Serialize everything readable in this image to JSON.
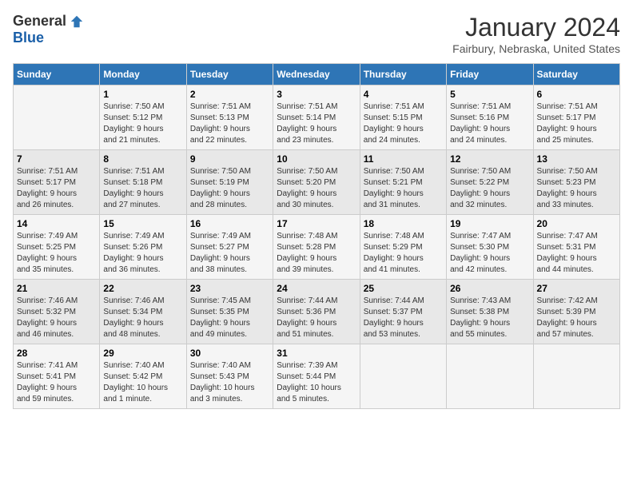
{
  "logo": {
    "general": "General",
    "blue": "Blue"
  },
  "title": "January 2024",
  "subtitle": "Fairbury, Nebraska, United States",
  "weekdays": [
    "Sunday",
    "Monday",
    "Tuesday",
    "Wednesday",
    "Thursday",
    "Friday",
    "Saturday"
  ],
  "weeks": [
    [
      {
        "day": "",
        "detail": ""
      },
      {
        "day": "1",
        "detail": "Sunrise: 7:50 AM\nSunset: 5:12 PM\nDaylight: 9 hours\nand 21 minutes."
      },
      {
        "day": "2",
        "detail": "Sunrise: 7:51 AM\nSunset: 5:13 PM\nDaylight: 9 hours\nand 22 minutes."
      },
      {
        "day": "3",
        "detail": "Sunrise: 7:51 AM\nSunset: 5:14 PM\nDaylight: 9 hours\nand 23 minutes."
      },
      {
        "day": "4",
        "detail": "Sunrise: 7:51 AM\nSunset: 5:15 PM\nDaylight: 9 hours\nand 24 minutes."
      },
      {
        "day": "5",
        "detail": "Sunrise: 7:51 AM\nSunset: 5:16 PM\nDaylight: 9 hours\nand 24 minutes."
      },
      {
        "day": "6",
        "detail": "Sunrise: 7:51 AM\nSunset: 5:17 PM\nDaylight: 9 hours\nand 25 minutes."
      }
    ],
    [
      {
        "day": "7",
        "detail": "Sunrise: 7:51 AM\nSunset: 5:17 PM\nDaylight: 9 hours\nand 26 minutes."
      },
      {
        "day": "8",
        "detail": "Sunrise: 7:51 AM\nSunset: 5:18 PM\nDaylight: 9 hours\nand 27 minutes."
      },
      {
        "day": "9",
        "detail": "Sunrise: 7:50 AM\nSunset: 5:19 PM\nDaylight: 9 hours\nand 28 minutes."
      },
      {
        "day": "10",
        "detail": "Sunrise: 7:50 AM\nSunset: 5:20 PM\nDaylight: 9 hours\nand 30 minutes."
      },
      {
        "day": "11",
        "detail": "Sunrise: 7:50 AM\nSunset: 5:21 PM\nDaylight: 9 hours\nand 31 minutes."
      },
      {
        "day": "12",
        "detail": "Sunrise: 7:50 AM\nSunset: 5:22 PM\nDaylight: 9 hours\nand 32 minutes."
      },
      {
        "day": "13",
        "detail": "Sunrise: 7:50 AM\nSunset: 5:23 PM\nDaylight: 9 hours\nand 33 minutes."
      }
    ],
    [
      {
        "day": "14",
        "detail": "Sunrise: 7:49 AM\nSunset: 5:25 PM\nDaylight: 9 hours\nand 35 minutes."
      },
      {
        "day": "15",
        "detail": "Sunrise: 7:49 AM\nSunset: 5:26 PM\nDaylight: 9 hours\nand 36 minutes."
      },
      {
        "day": "16",
        "detail": "Sunrise: 7:49 AM\nSunset: 5:27 PM\nDaylight: 9 hours\nand 38 minutes."
      },
      {
        "day": "17",
        "detail": "Sunrise: 7:48 AM\nSunset: 5:28 PM\nDaylight: 9 hours\nand 39 minutes."
      },
      {
        "day": "18",
        "detail": "Sunrise: 7:48 AM\nSunset: 5:29 PM\nDaylight: 9 hours\nand 41 minutes."
      },
      {
        "day": "19",
        "detail": "Sunrise: 7:47 AM\nSunset: 5:30 PM\nDaylight: 9 hours\nand 42 minutes."
      },
      {
        "day": "20",
        "detail": "Sunrise: 7:47 AM\nSunset: 5:31 PM\nDaylight: 9 hours\nand 44 minutes."
      }
    ],
    [
      {
        "day": "21",
        "detail": "Sunrise: 7:46 AM\nSunset: 5:32 PM\nDaylight: 9 hours\nand 46 minutes."
      },
      {
        "day": "22",
        "detail": "Sunrise: 7:46 AM\nSunset: 5:34 PM\nDaylight: 9 hours\nand 48 minutes."
      },
      {
        "day": "23",
        "detail": "Sunrise: 7:45 AM\nSunset: 5:35 PM\nDaylight: 9 hours\nand 49 minutes."
      },
      {
        "day": "24",
        "detail": "Sunrise: 7:44 AM\nSunset: 5:36 PM\nDaylight: 9 hours\nand 51 minutes."
      },
      {
        "day": "25",
        "detail": "Sunrise: 7:44 AM\nSunset: 5:37 PM\nDaylight: 9 hours\nand 53 minutes."
      },
      {
        "day": "26",
        "detail": "Sunrise: 7:43 AM\nSunset: 5:38 PM\nDaylight: 9 hours\nand 55 minutes."
      },
      {
        "day": "27",
        "detail": "Sunrise: 7:42 AM\nSunset: 5:39 PM\nDaylight: 9 hours\nand 57 minutes."
      }
    ],
    [
      {
        "day": "28",
        "detail": "Sunrise: 7:41 AM\nSunset: 5:41 PM\nDaylight: 9 hours\nand 59 minutes."
      },
      {
        "day": "29",
        "detail": "Sunrise: 7:40 AM\nSunset: 5:42 PM\nDaylight: 10 hours\nand 1 minute."
      },
      {
        "day": "30",
        "detail": "Sunrise: 7:40 AM\nSunset: 5:43 PM\nDaylight: 10 hours\nand 3 minutes."
      },
      {
        "day": "31",
        "detail": "Sunrise: 7:39 AM\nSunset: 5:44 PM\nDaylight: 10 hours\nand 5 minutes."
      },
      {
        "day": "",
        "detail": ""
      },
      {
        "day": "",
        "detail": ""
      },
      {
        "day": "",
        "detail": ""
      }
    ]
  ]
}
